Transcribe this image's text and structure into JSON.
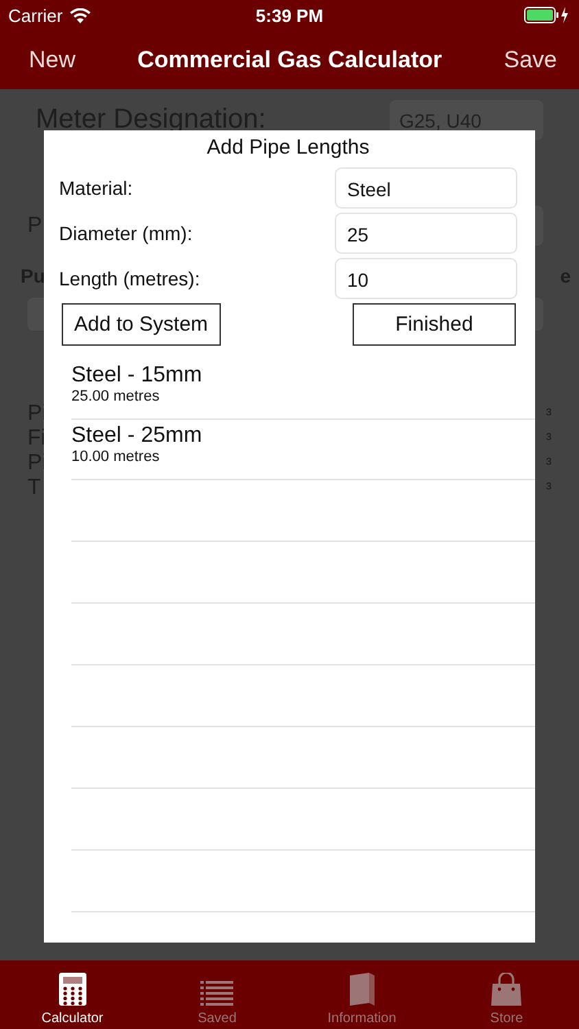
{
  "status_bar": {
    "carrier": "Carrier",
    "time": "5:39 PM"
  },
  "nav_bar": {
    "left": "New",
    "title": "Commercial Gas Calculator",
    "right": "Save"
  },
  "background": {
    "meter_label": "Meter Designation:",
    "meter_value": "G25, U40",
    "fragment_row_2": "P",
    "fragment_bold_left": "Pu",
    "fragment_bold_right": "e",
    "result_fragments": [
      {
        "left": "Pi",
        "right": "³"
      },
      {
        "left": "Fi",
        "right": "³"
      },
      {
        "left": "Pi",
        "right": "³"
      },
      {
        "left": "T",
        "right": "³"
      }
    ]
  },
  "dialog": {
    "title": "Add Pipe Lengths",
    "fields": [
      {
        "label": "Material:",
        "value": "Steel"
      },
      {
        "label": "Diameter (mm):",
        "value": "25"
      },
      {
        "label": "Length (metres):",
        "value": "10"
      }
    ],
    "buttons": [
      "Add to System",
      "Finished"
    ],
    "items": [
      {
        "title": "Steel - 15mm",
        "subtitle": "25.00 metres"
      },
      {
        "title": "Steel - 25mm",
        "subtitle": "10.00 metres"
      }
    ]
  },
  "tab_bar": [
    {
      "label": "Calculator",
      "selected": true
    },
    {
      "label": "Saved",
      "selected": false
    },
    {
      "label": "Information",
      "selected": false
    },
    {
      "label": "Store",
      "selected": false
    }
  ]
}
